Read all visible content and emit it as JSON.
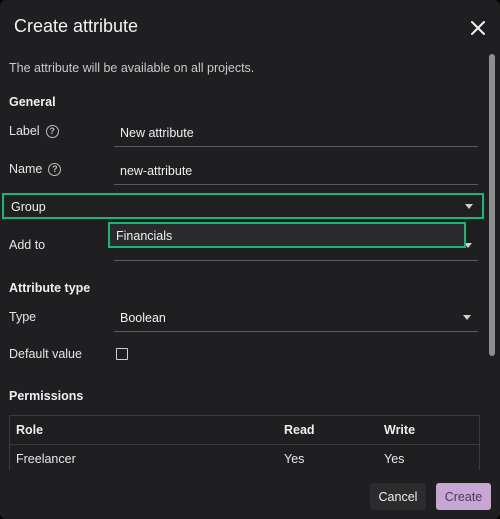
{
  "dialog": {
    "title": "Create attribute",
    "description": "The attribute will be available on all projects.",
    "accent_color": "#17b877",
    "primary_color": "#c7a6d6"
  },
  "general": {
    "heading": "General",
    "label_label": "Label",
    "label_value": "New attribute",
    "name_label": "Name",
    "name_value": "new-attribute",
    "group_label": "Group",
    "group_option": "Financials",
    "add_to_label": "Add to"
  },
  "attribute_type": {
    "heading": "Attribute type",
    "type_label": "Type",
    "type_value": "Boolean",
    "default_label": "Default value"
  },
  "permissions": {
    "heading": "Permissions",
    "columns": [
      "Role",
      "Read",
      "Write"
    ],
    "rows": [
      [
        "Freelancer",
        "Yes",
        "Yes"
      ]
    ]
  },
  "footer": {
    "cancel_label": "Cancel",
    "create_label": "Create"
  },
  "icons": {
    "close": "close-icon",
    "help": "help-circle-icon",
    "caret": "chevron-down-icon",
    "checkbox": "checkbox-unchecked"
  }
}
